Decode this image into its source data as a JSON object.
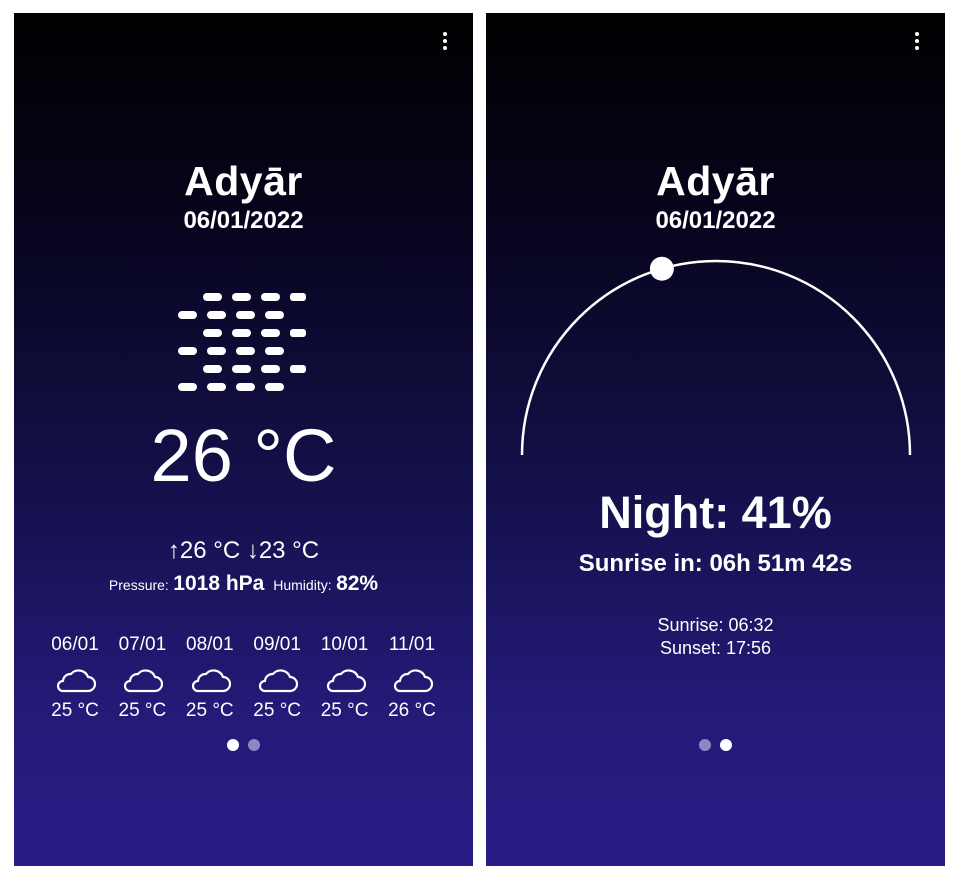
{
  "screens": [
    {
      "city": "Adyār",
      "date": "06/01/2022",
      "current": {
        "icon": "fog-icon",
        "temperature": "26 °C",
        "max_min": "↑26 °C ↓23 °C",
        "pressure_label": "Pressure:",
        "pressure_value": "1018 hPa",
        "humidity_label": "Humidity:",
        "humidity_value": "82%"
      },
      "forecast": [
        {
          "date": "06/01",
          "icon": "cloud-icon",
          "temp": "25 °C"
        },
        {
          "date": "07/01",
          "icon": "cloud-icon",
          "temp": "25 °C"
        },
        {
          "date": "08/01",
          "icon": "cloud-icon",
          "temp": "25 °C"
        },
        {
          "date": "09/01",
          "icon": "cloud-icon",
          "temp": "25 °C"
        },
        {
          "date": "10/01",
          "icon": "cloud-icon",
          "temp": "25 °C"
        },
        {
          "date": "11/01",
          "icon": "cloud-icon",
          "temp": "26 °C"
        }
      ],
      "page_indicator": {
        "active": 1,
        "count": 2
      }
    },
    {
      "city": "Adyār",
      "date": "06/01/2022",
      "night_status": "Night: 41%",
      "night_progress": 0.41,
      "countdown": "Sunrise in: 06h 51m 42s",
      "sunrise": "Sunrise: 06:32",
      "sunset": "Sunset: 17:56",
      "page_indicator": {
        "active": 2,
        "count": 2
      }
    }
  ],
  "colors": {
    "background_top": "#000000",
    "background_bottom": "#2a1c86",
    "text": "#ffffff",
    "indicator_inactive": "#8f87c3"
  }
}
